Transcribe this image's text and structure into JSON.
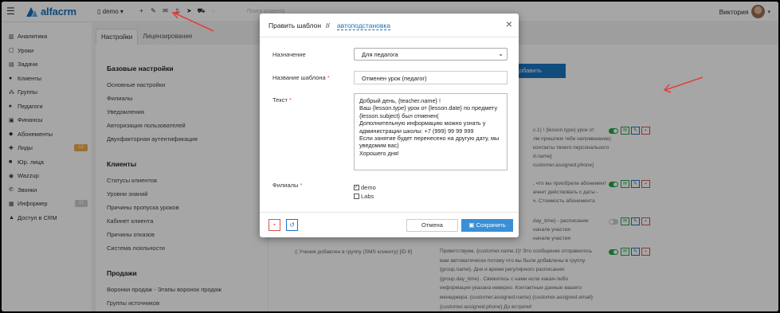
{
  "topbar": {
    "logo_text": "alfacrm",
    "branch": "demo",
    "search_placeholder": "Поиск клиента",
    "user_name": "Виктория",
    "icons": [
      "plus-icon",
      "wrench-icon",
      "mail-icon",
      "phone-icon",
      "send-icon",
      "cart-icon",
      "circle-icon"
    ]
  },
  "sidebar": {
    "items": [
      {
        "label": "Аналитика",
        "icon": "chart-icon"
      },
      {
        "label": "Уроки",
        "icon": "calendar-icon"
      },
      {
        "label": "Задачи",
        "icon": "tasks-icon"
      },
      {
        "label": "Клиенты",
        "icon": "user-icon"
      },
      {
        "label": "Группы",
        "icon": "group-icon"
      },
      {
        "label": "Педагоги",
        "icon": "teacher-icon"
      },
      {
        "label": "Финансы",
        "icon": "finance-icon"
      },
      {
        "label": "Абонементы",
        "icon": "tag-icon"
      },
      {
        "label": "Лиды",
        "icon": "leads-icon",
        "count": "12"
      },
      {
        "label": "Юр. лица",
        "icon": "briefcase-icon"
      },
      {
        "label": "Wazzup",
        "icon": "whatsapp-icon"
      },
      {
        "label": "Звонки",
        "icon": "phone-icon"
      },
      {
        "label": "Информер",
        "icon": "informer-icon",
        "count": "11"
      },
      {
        "label": "Доступ в CRM",
        "icon": "lock-icon"
      }
    ]
  },
  "tabs": [
    {
      "label": "Настройки"
    },
    {
      "label": "Лицензирование"
    }
  ],
  "settings": {
    "base_title": "Базовые настройки",
    "base_items": [
      "Основные настройки",
      "Филиалы",
      "Уведомления",
      "Авторизация пользователей",
      "Двухфакторная аутентификация"
    ],
    "clients_title": "Клиенты",
    "clients_items": [
      "Статусы клиентов",
      "Уровни знаний",
      "Причины пропуска уроков",
      "Кабинет клиента",
      "Причины отказов",
      "Система лояльности"
    ],
    "sales_title": "Продажи",
    "sales_items": [
      "Воронки продаж - Этапы воронок продаж",
      "Группы источников"
    ]
  },
  "list": {
    "add_button": "+ Добавить",
    "row_texts": [
      "с.1) ! {lesson.type} урок от",
      "лм пришлем тебе напоминание)",
      "контакты твоего персонального",
      "d.name}",
      "customer.assigned.phone}",
      ", что вы приобрели абонемент",
      "ачнет действовать с даты -",
      "ч. Стоимость абонемента",
      "day_time} - расписание",
      "начале участия",
      "начале участия"
    ],
    "row_label": "Ученик добавлен в группу (SMS клиенту)",
    "row_id": "[ID 8]",
    "row_message": "Приветствуем, {customer.name.1}! Это сообщение отправилось вам автоматически потому что вы были добавлены в группу {group.name}. Дни и время регулярного расписания: {group.day_time} . Свяжитесь с нами если какая-либо информация указана неверно. Контактные данные вашего менеджера: {customer.assigned.name} {customer.assigned.email} {customer.assigned.phone} До встречи!"
  },
  "modal": {
    "title": "Править шаблон",
    "separator": "//",
    "link": "автоподстановка",
    "close": "×",
    "purpose_label": "Назначение",
    "purpose_value": "Для педагога",
    "name_label": "Название шаблона",
    "name_value": "Отменен урок (педагог)",
    "text_label": "Текст",
    "text_value": "Добрый день, {teacher.name} !\nВаш {lesson.type} урок от {lesson.date} по предмету {lesson.subject} был отменен(\nДополнительную информацию можно узнать у администрации школы: +7 (999) 99 99 999\nЕсли занятие будет перенесено на другую дату, мы уведомим вас)\nХорошего дня!",
    "branches_label": "Филиалы",
    "branches": [
      {
        "label": "demo",
        "checked": true
      },
      {
        "label": "Labs",
        "checked": false
      }
    ],
    "cancel": "Отмена",
    "save": "Сохранить"
  },
  "colors": {
    "accent": "#1b76c0",
    "annotation_arrow": "#e2413b",
    "toggle_on": "#28a745"
  }
}
